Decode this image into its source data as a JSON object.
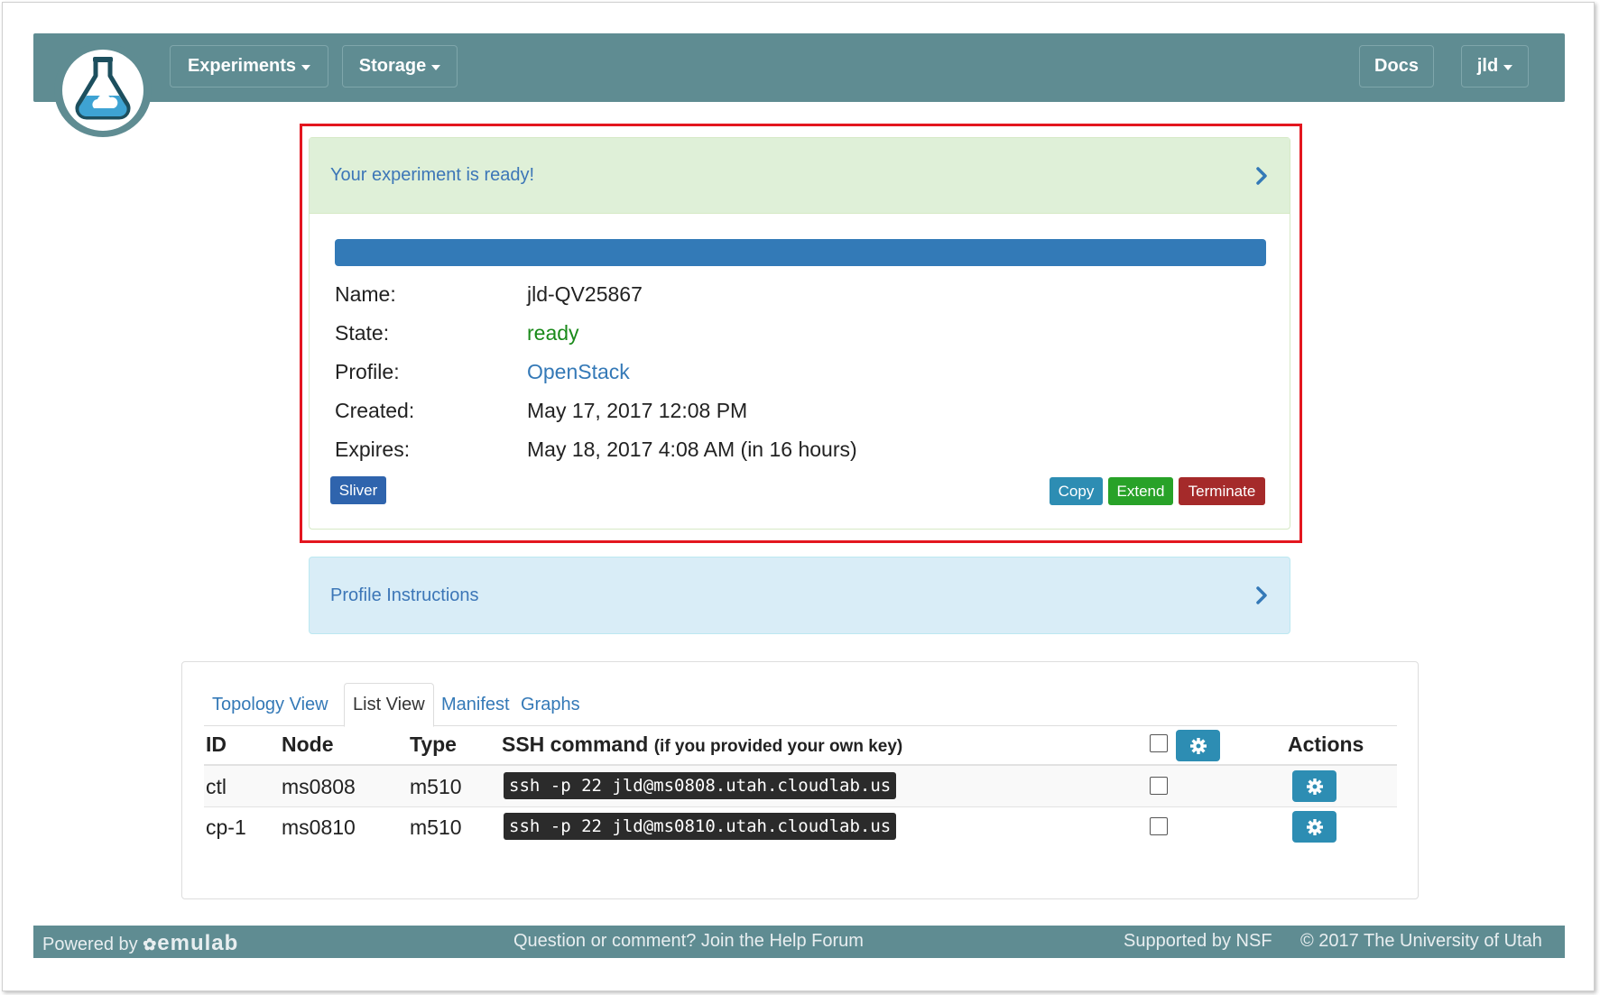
{
  "navbar": {
    "experiments_label": "Experiments",
    "storage_label": "Storage",
    "docs_label": "Docs",
    "user_label": "jld"
  },
  "status_panel": {
    "heading": "Your experiment is ready!",
    "progress_percent": 100,
    "fields": {
      "name_label": "Name:",
      "name_value": "jld-QV25867",
      "state_label": "State:",
      "state_value": "ready",
      "profile_label": "Profile:",
      "profile_value": "OpenStack",
      "created_label": "Created:",
      "created_value": "May 17, 2017 12:08 PM",
      "expires_label": "Expires:",
      "expires_value": "May 18, 2017 4:08 AM (in 16 hours)"
    },
    "buttons": {
      "sliver": "Sliver",
      "copy": "Copy",
      "extend": "Extend",
      "terminate": "Terminate"
    }
  },
  "instructions_panel": {
    "heading": "Profile Instructions"
  },
  "list_panel": {
    "tabs": [
      "Topology View",
      "List View",
      "Manifest",
      "Graphs"
    ],
    "active_tab": "List View",
    "headers": {
      "id": "ID",
      "node": "Node",
      "type": "Type",
      "ssh": "SSH command",
      "ssh_note": "(if you provided your own key)",
      "actions": "Actions"
    },
    "rows": [
      {
        "id": "ctl",
        "node": "ms0808",
        "type": "m510",
        "ssh": "ssh -p 22 jld@ms0808.utah.cloudlab.us"
      },
      {
        "id": "cp-1",
        "node": "ms0810",
        "type": "m510",
        "ssh": "ssh -p 22 jld@ms0810.utah.cloudlab.us"
      }
    ]
  },
  "footer": {
    "powered_by": "Powered by",
    "brand": "emulab",
    "help": "Question or comment? Join the Help Forum",
    "nsf": "Supported by NSF",
    "copyright": "© 2017 The University of Utah"
  },
  "colors": {
    "navbar": "#5f8c92",
    "primary": "#337ab7",
    "success": "#28a228",
    "danger": "#a52a2a",
    "info": "#2d8db3"
  }
}
